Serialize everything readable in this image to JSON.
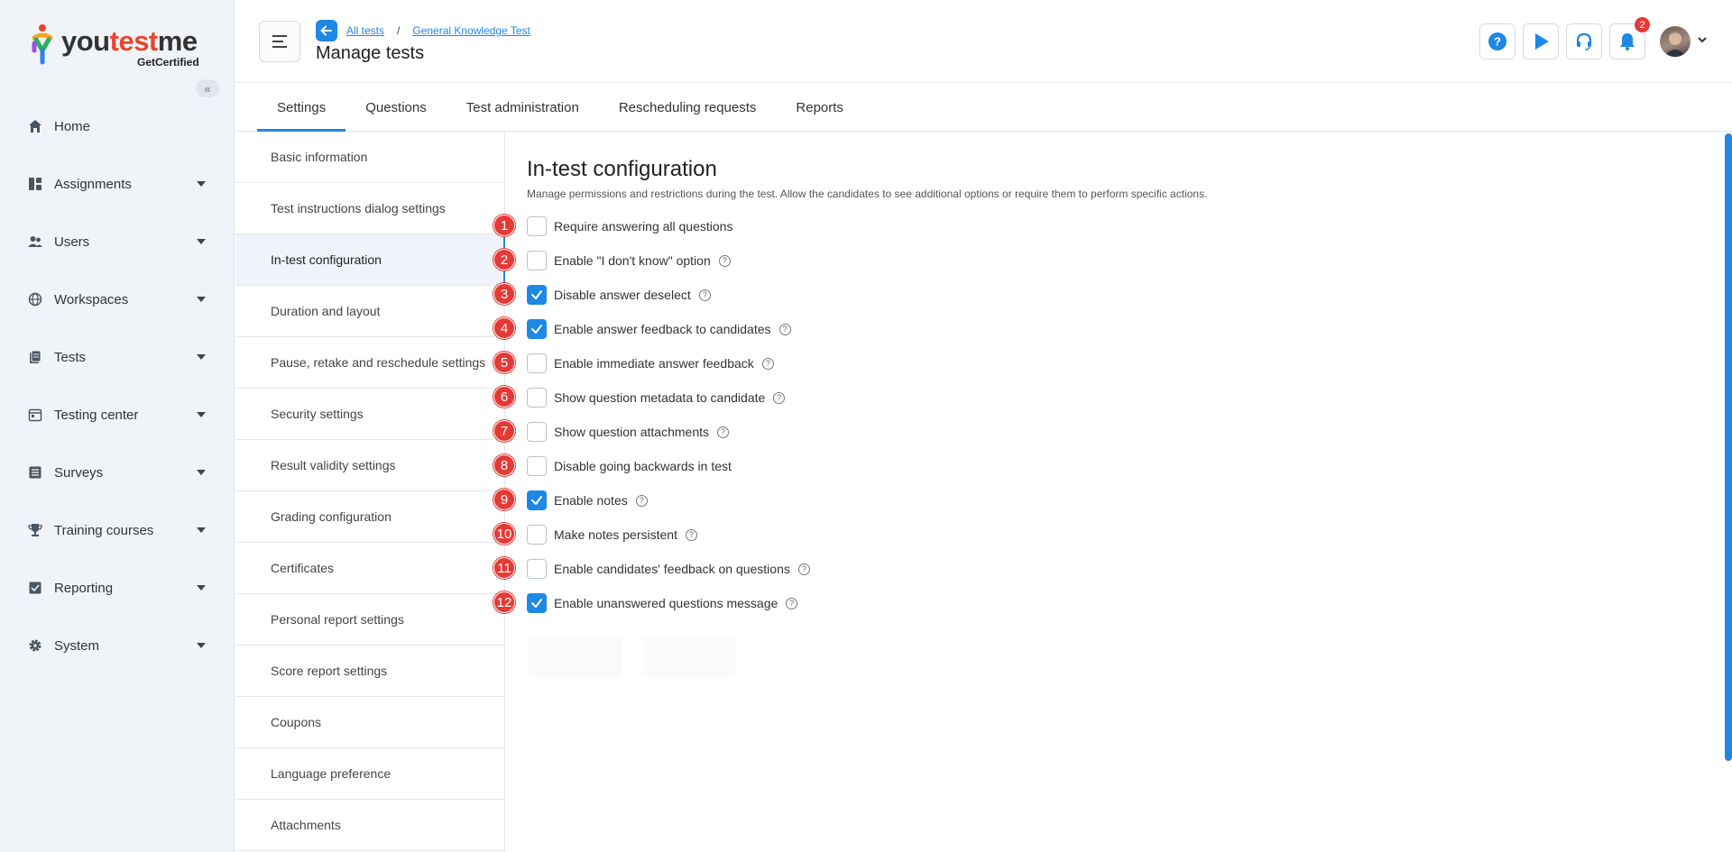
{
  "brand": {
    "name_part1": "you",
    "name_part2": "test",
    "name_part3": "me",
    "sub": "GetCertified"
  },
  "sidebar": {
    "collapse_glyph": "«",
    "items": [
      {
        "label": "Home",
        "icon": "home-icon"
      },
      {
        "label": "Assignments",
        "icon": "assignments-icon"
      },
      {
        "label": "Users",
        "icon": "users-icon"
      },
      {
        "label": "Workspaces",
        "icon": "globe-icon"
      },
      {
        "label": "Tests",
        "icon": "tests-icon"
      },
      {
        "label": "Testing center",
        "icon": "calendar-icon"
      },
      {
        "label": "Surveys",
        "icon": "list-icon"
      },
      {
        "label": "Training courses",
        "icon": "trophy-icon"
      },
      {
        "label": "Reporting",
        "icon": "report-icon"
      },
      {
        "label": "System",
        "icon": "gear-icon"
      }
    ]
  },
  "header": {
    "breadcrumb": {
      "root": "All tests",
      "sep": "/",
      "current": "General Knowledge Test"
    },
    "title": "Manage tests",
    "help_glyph": "?",
    "notification_count": "2"
  },
  "tabs": [
    "Settings",
    "Questions",
    "Test administration",
    "Rescheduling requests",
    "Reports"
  ],
  "subnav": [
    "Basic information",
    "Test instructions dialog settings",
    "In-test configuration",
    "Duration and layout",
    "Pause, retake and reschedule settings",
    "Security settings",
    "Result validity settings",
    "Grading configuration",
    "Certificates",
    "Personal report settings",
    "Score report settings",
    "Coupons",
    "Language preference",
    "Attachments"
  ],
  "main": {
    "title": "In-test configuration",
    "description": "Manage permissions and restrictions during the test. Allow the candidates to see additional options or require them to perform specific actions.",
    "options": [
      {
        "n": "1",
        "label": "Require answering all questions",
        "checked": false,
        "help": false
      },
      {
        "n": "2",
        "label": "Enable \"I don't know\" option",
        "checked": false,
        "help": true
      },
      {
        "n": "3",
        "label": "Disable answer deselect",
        "checked": true,
        "help": true
      },
      {
        "n": "4",
        "label": "Enable answer feedback to candidates",
        "checked": true,
        "help": true
      },
      {
        "n": "5",
        "label": "Enable immediate answer feedback",
        "checked": false,
        "help": true
      },
      {
        "n": "6",
        "label": "Show question metadata to candidate",
        "checked": false,
        "help": true
      },
      {
        "n": "7",
        "label": "Show question attachments",
        "checked": false,
        "help": true
      },
      {
        "n": "8",
        "label": "Disable going backwards in test",
        "checked": false,
        "help": false
      },
      {
        "n": "9",
        "label": "Enable notes",
        "checked": true,
        "help": true
      },
      {
        "n": "10",
        "label": "Make notes persistent",
        "checked": false,
        "help": true
      },
      {
        "n": "11",
        "label": "Enable candidates' feedback on questions",
        "checked": false,
        "help": true
      },
      {
        "n": "12",
        "label": "Enable unanswered questions message",
        "checked": true,
        "help": true
      }
    ]
  },
  "colors": {
    "accent": "#1e88e5",
    "marker": "#e53935"
  }
}
